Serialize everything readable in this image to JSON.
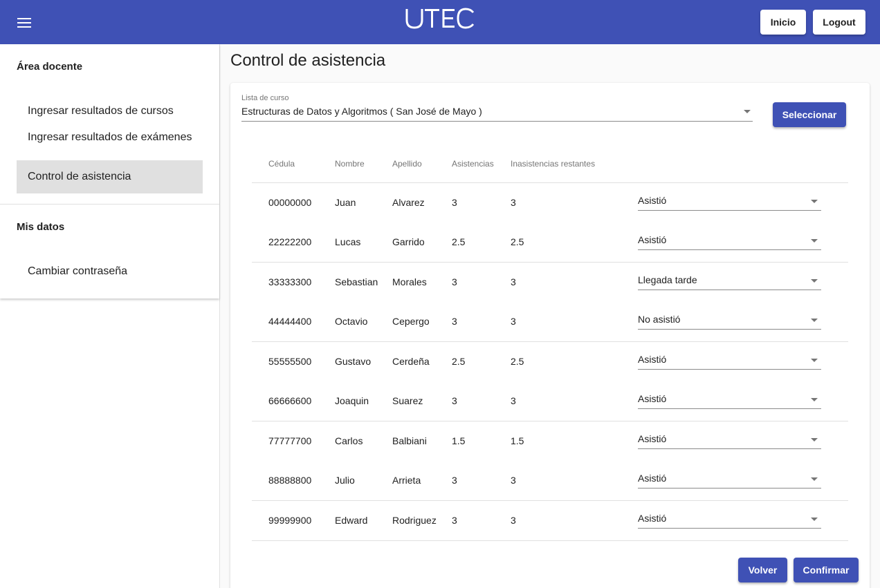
{
  "header": {
    "logo_text": "UTEC",
    "buttons": {
      "inicio": "Inicio",
      "logout": "Logout"
    },
    "background_color": "#3f51b5"
  },
  "sidebar": {
    "sections": [
      {
        "title": "Área docente",
        "items": [
          {
            "label": "Ingresar resultados de cursos",
            "active": false
          },
          {
            "label": "Ingresar resultados de exámenes",
            "active": false
          },
          {
            "label": "Control de asistencia",
            "active": true
          }
        ]
      },
      {
        "title": "Mis datos",
        "items": [
          {
            "label": "Cambiar contraseña",
            "active": false
          }
        ]
      }
    ]
  },
  "main": {
    "title": "Control de asistencia",
    "course_field": {
      "label": "Lista de curso",
      "value": "Estructuras de Datos y Algoritmos ( San José de Mayo )"
    },
    "select_button": "Seleccionar",
    "table": {
      "headers": [
        "Cédula",
        "Nombre",
        "Apellido",
        "Asistencias",
        "Inasistencias restantes"
      ],
      "rows": [
        {
          "cedula": "00000000",
          "nombre": "Juan",
          "apellido": "Alvarez",
          "asistencias": "3",
          "inasistencias": "3",
          "estado": "Asistió"
        },
        {
          "cedula": "22222200",
          "nombre": "Lucas",
          "apellido": "Garrido",
          "asistencias": "2.5",
          "inasistencias": "2.5",
          "estado": "Asistió"
        },
        {
          "cedula": "33333300",
          "nombre": "Sebastian",
          "apellido": "Morales",
          "asistencias": "3",
          "inasistencias": "3",
          "estado": "Llegada tarde"
        },
        {
          "cedula": "44444400",
          "nombre": "Octavio",
          "apellido": "Cepergo",
          "asistencias": "3",
          "inasistencias": "3",
          "estado": "No asistió"
        },
        {
          "cedula": "55555500",
          "nombre": "Gustavo",
          "apellido": "Cerdeña",
          "asistencias": "2.5",
          "inasistencias": "2.5",
          "estado": "Asistió"
        },
        {
          "cedula": "66666600",
          "nombre": "Joaquin",
          "apellido": "Suarez",
          "asistencias": "3",
          "inasistencias": "3",
          "estado": "Asistió"
        },
        {
          "cedula": "77777700",
          "nombre": "Carlos",
          "apellido": "Balbiani",
          "asistencias": "1.5",
          "inasistencias": "1.5",
          "estado": "Asistió"
        },
        {
          "cedula": "88888800",
          "nombre": "Julio",
          "apellido": "Arrieta",
          "asistencias": "3",
          "inasistencias": "3",
          "estado": "Asistió"
        },
        {
          "cedula": "99999900",
          "nombre": "Edward",
          "apellido": "Rodriguez",
          "asistencias": "3",
          "inasistencias": "3",
          "estado": "Asistió"
        }
      ]
    },
    "actions": {
      "volver": "Volver",
      "confirmar": "Confirmar"
    }
  }
}
